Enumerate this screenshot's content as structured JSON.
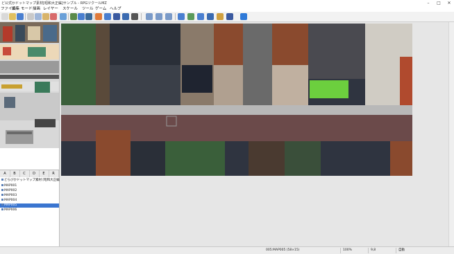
{
  "window": {
    "title": "ど公式かドットマップ素材[昭和大正編]サンプル - RPGツクールMZ",
    "minimize": "–",
    "maximize": "□",
    "close": "✕"
  },
  "menu": [
    "ファイル",
    "編集",
    "モード",
    "描画",
    "レイヤー",
    "スケール",
    "ツール",
    "ゲーム",
    "ヘルプ"
  ],
  "toolbar_icons": [
    "new-icon",
    "open-icon",
    "save-icon",
    "cut-icon",
    "copy-icon",
    "paste-icon",
    "delete-icon",
    "undo-icon",
    "map-mode-icon",
    "event-mode-icon",
    "region-icon",
    "pencil-icon",
    "rectangle-icon",
    "ellipse-icon",
    "fill-icon",
    "shadow-pen-icon",
    "zoom-in-icon",
    "zoom-out-icon",
    "zoom-actual-icon",
    "database-icon",
    "plugin-icon",
    "sound-icon",
    "event-search-icon",
    "resource-icon",
    "character-generator-icon",
    "playtest-icon"
  ],
  "palette_tabs": [
    "A",
    "B",
    "C",
    "D",
    "E",
    "R"
  ],
  "tree": {
    "project": "どらびかドットマップ素材 [昭和大正編]",
    "maps": [
      "MAP001",
      "MAP002",
      "MAP003",
      "MAP004",
      "MAP005",
      "MAP006"
    ],
    "selected_map": "MAP005"
  },
  "status": {
    "map_info": "005:MAP005 (58×15)",
    "zoom": "100%",
    "coordinates": "9,8",
    "tile": "自動"
  },
  "colors": {
    "accent": "#3a75d0",
    "road": "#6b4a4a",
    "sidewalk": "#b8b8b8",
    "wood_dark": "#2f3440",
    "wood_brown": "#8a4a2e",
    "green": "#3a5f3a",
    "grass": "#6ccf3e"
  }
}
